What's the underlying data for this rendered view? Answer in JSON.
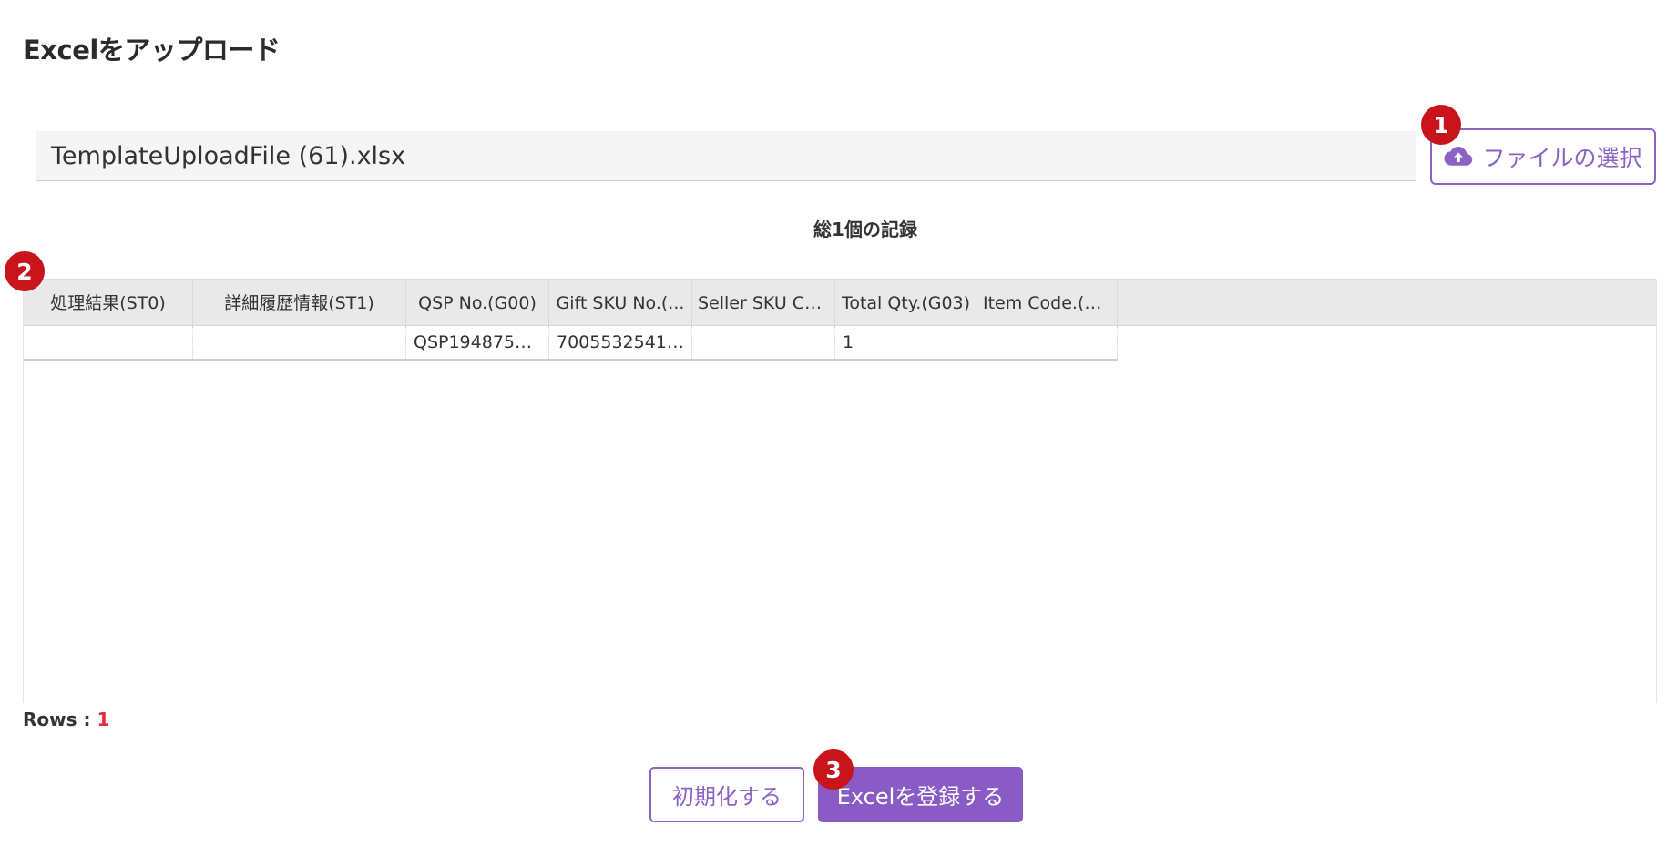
{
  "page": {
    "title": "Excelをアップロード"
  },
  "upload": {
    "file_name": "TemplateUploadFile (61).xlsx",
    "select_label": "ファイルの選択"
  },
  "summary": {
    "record_count_text": "総1個の記録"
  },
  "table": {
    "columns": [
      "処理結果(ST0)",
      "詳細履歴情報(ST1)",
      "QSP No.(G00)",
      "Gift SKU No.(...",
      "Seller SKU Co...",
      "Total Qty.(G03)",
      "Item Code.(G..."
    ],
    "rows": [
      [
        "",
        "",
        "QSP1948755...",
        "70055325410...",
        "",
        "1",
        ""
      ]
    ]
  },
  "footer": {
    "rows_label": "Rows : ",
    "rows_value": "1"
  },
  "actions": {
    "reset_label": "初期化する",
    "register_label": "Excelを登録する"
  },
  "badges": [
    "1",
    "2",
    "3"
  ],
  "colors": {
    "accent": "#8a5bc6",
    "badge": "#c9141c",
    "count": "#e8283a"
  }
}
